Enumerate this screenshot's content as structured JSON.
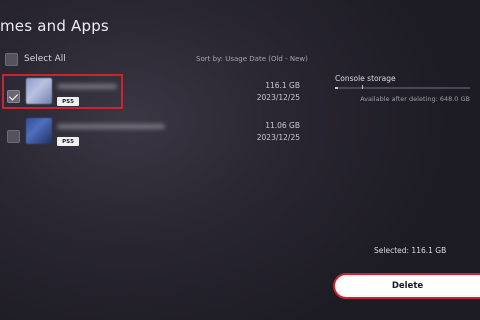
{
  "header": {
    "title": "mes and Apps"
  },
  "toolbar": {
    "select_all_label": "Select All",
    "sort_label": "Sort by: Usage Date (Old - New)"
  },
  "games": [
    {
      "size": "116.1 GB",
      "date": "2023/12/25",
      "platform": "PS5",
      "checked": true
    },
    {
      "size": "11.06 GB",
      "date": "2023/12/25",
      "platform": "PS5",
      "checked": false
    }
  ],
  "storage": {
    "label": "Console storage",
    "available_text": "Available after deleting: 648.0 GB",
    "used_fraction": 0.02
  },
  "footer": {
    "selected_text": "Selected:  116.1 GB",
    "delete_label": "Delete"
  },
  "colors": {
    "highlight": "#c92430",
    "background": "#1d1b23"
  }
}
